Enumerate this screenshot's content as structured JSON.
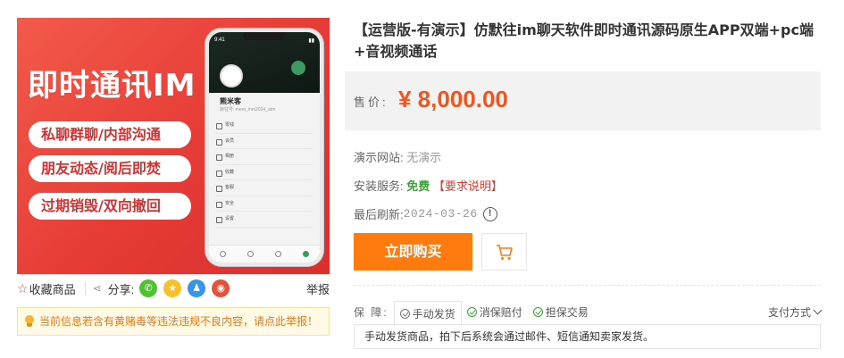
{
  "product": {
    "title": "【运营版-有演示】仿默往im聊天软件即时通讯源码原生APP双端+pc端+音视频通话",
    "hero": {
      "headline": "即时通讯IM",
      "pills": [
        "私聊群聊/内部沟通",
        "朋友动态/阅后即焚",
        "过期销毁/双向撤回"
      ],
      "phone": {
        "status_time": "9:41",
        "profile_name": "熊米客",
        "profile_sub": "默往号: meet_mm2024_atm",
        "menu": [
          "零钱",
          "会员",
          "相册",
          "收藏",
          "客服",
          "安全",
          "设置"
        ]
      }
    }
  },
  "price": {
    "label": "售价:",
    "value": "¥ 8,000.00"
  },
  "info": {
    "demo_label": "演示网站:",
    "demo_value": "无演示",
    "service_label": "安装服务:",
    "service_free": "免费",
    "service_req": "【要求说明】",
    "updated_label": "最后刷新:",
    "updated_value": "2024-03-26"
  },
  "actions": {
    "buy_label": "立即购买"
  },
  "share": {
    "favorite_label": "收藏商品",
    "share_label": "分享:",
    "report_label": "举报",
    "icons": [
      "wechat-icon",
      "qzone-icon",
      "qq-icon",
      "weibo-icon"
    ]
  },
  "warning": {
    "text": "当前信息若含有黄赌毒等违法违规不良内容，请点此举报！"
  },
  "guarantee": {
    "label": "保 障:",
    "tags": [
      "手动发货",
      "消保赔付",
      "担保交易"
    ],
    "pay_label": "支付方式",
    "description": "手动发货商品，拍下后系统会通过邮件、短信通知卖家发货。"
  },
  "colors": {
    "accent": "#ff7a0f",
    "price": "#f0551f",
    "hero_red": "#e63b36"
  }
}
